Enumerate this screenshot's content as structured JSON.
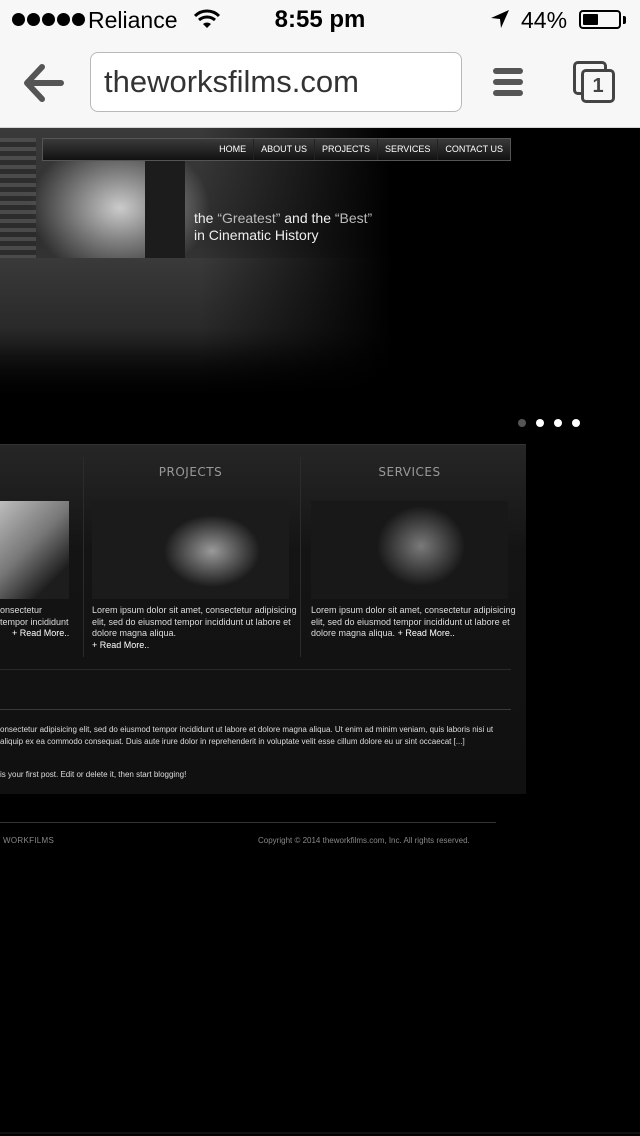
{
  "status_bar": {
    "carrier": "Reliance",
    "time": "8:55 pm",
    "battery_percent": "44%",
    "battery_level": 0.44
  },
  "browser": {
    "url": "theworksfilms.com",
    "tab_count": "1"
  },
  "site": {
    "nav": [
      "HOME",
      "ABOUT US",
      "PROJECTS",
      "SERVICES",
      "CONTACT US"
    ],
    "tagline_line1_parts": [
      "the ",
      "“Greatest”",
      " and the ",
      "“Best”"
    ],
    "tagline_line2": "in Cinematic History",
    "slider_dots": 4,
    "columns": [
      {
        "title": "",
        "text": "onsectetur",
        "text2": "tempor incididunt",
        "text3": "+ Read More.."
      },
      {
        "title": "PROJECTS",
        "text": "Lorem ipsum dolor sit amet, consectetur adipisicing elit, sed do eiusmod tempor incididunt ut labore et dolore magna aliqua.",
        "more": "+ Read More.."
      },
      {
        "title": "SERVICES",
        "text": "Lorem ipsum dolor sit amet, consectetur adipisicing elit, sed do eiusmod tempor incididunt ut labore et dolore magna aliqua.",
        "more": "+ Read More.."
      }
    ],
    "post_text": "onsectetur adipisicing elit, sed do eiusmod tempor incididunt ut labore et dolore magna aliqua. Ut enim ad minim veniam, quis laboris nisi ut aliquip ex ea commodo consequat. Duis aute irure dolor in reprehenderit in voluptate velit esse cillum dolore eu ur sint occaecat [...]",
    "post_text2": "is your first post. Edit or delete it, then start blogging!",
    "footer_left": "WORKFILMS",
    "footer_right": "Copyright © 2014 theworkfilms.com, Inc. All rights reserved."
  }
}
